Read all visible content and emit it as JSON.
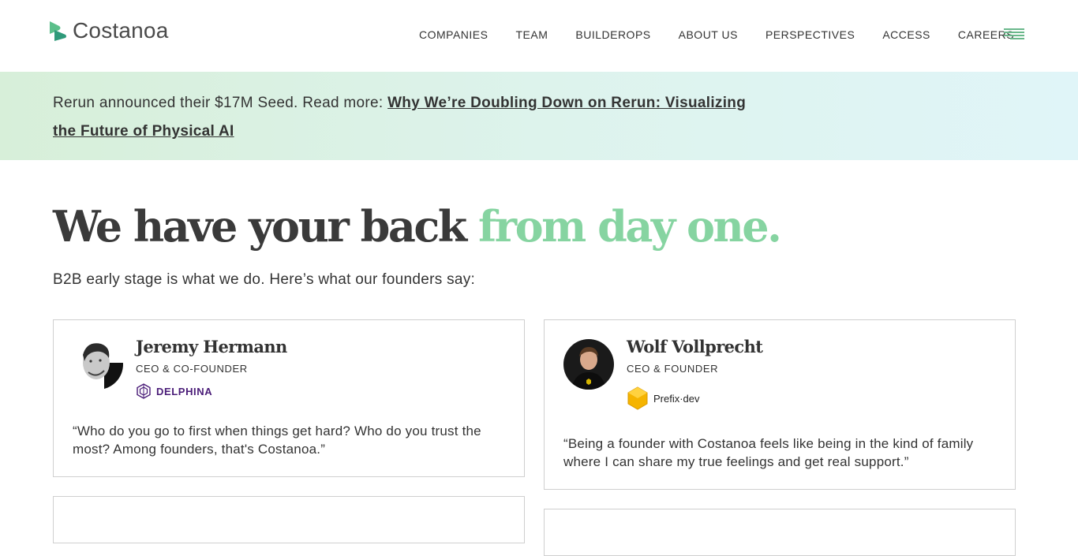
{
  "brand": {
    "name": "Costanoa",
    "accent_color": "#6ab88b",
    "icon": "costanoa-logo-icon"
  },
  "nav": {
    "items": [
      "COMPANIES",
      "TEAM",
      "BUILDEROPS",
      "ABOUT US",
      "PERSPECTIVES",
      "ACCESS",
      "CAREERS"
    ],
    "menu_icon": "hamburger-menu-icon"
  },
  "banner": {
    "text": "Rerun announced their $17M Seed. Read more: ",
    "link": "Why We’re Doubling Down on Rerun: Visualizing the Future of Physical AI"
  },
  "hero": {
    "title_main": "We have your back ",
    "title_accent": "from day one.",
    "subtitle": "B2B early stage is what we do. Here’s what our founders say:"
  },
  "testimonials": [
    {
      "name": "Jeremy Hermann",
      "role": "CEO & CO-FOUNDER",
      "company": "DELPHINA",
      "company_color": "#4a1c78",
      "quote": "“Who do you go to first when things get hard? Who do you trust the most? Among founders, that's Costanoa.”"
    },
    {
      "name": "Wolf Vollprecht",
      "role": "CEO & FOUNDER",
      "company": "Prefix·dev",
      "company_color": "#f5b400",
      "quote": "“Being a founder with Costanoa feels like being in the kind of family where I can share my true feelings and get real support.”"
    }
  ]
}
